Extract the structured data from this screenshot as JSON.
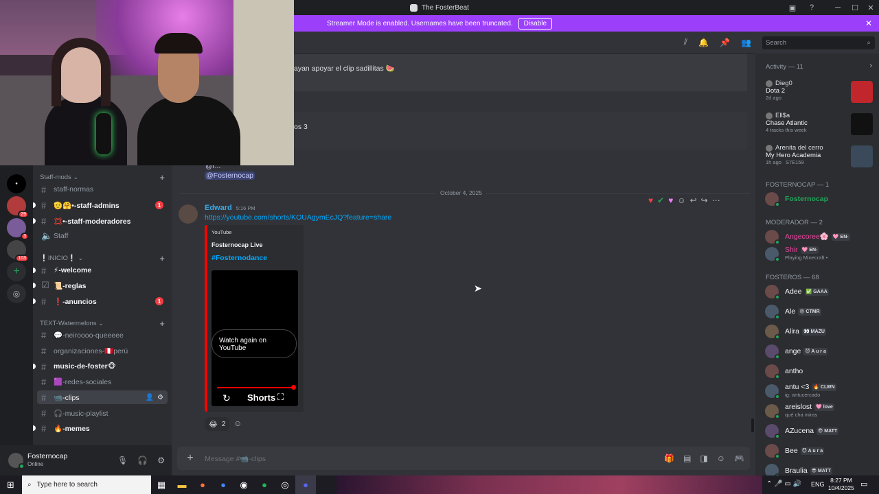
{
  "window": {
    "title": "The FosterBeat"
  },
  "banner": {
    "text": "Streamer Mode is enabled. Usernames have been truncated.",
    "button": "Disable"
  },
  "search": {
    "placeholder": "Search"
  },
  "servers": [
    {
      "badge": ""
    },
    {
      "badge": "29"
    },
    {
      "badge": "3"
    },
    {
      "badge": "103"
    }
  ],
  "sidebar": {
    "categories": [
      {
        "label": "Staff-mods"
      },
      {
        "label": "❕INICIO❕"
      },
      {
        "label": "TEXT-Watermelons"
      }
    ],
    "channels": [
      {
        "name": "staff-normas",
        "badge": ""
      },
      {
        "name": "🫡🤗•-staff-admins",
        "badge": "1"
      },
      {
        "name": "💢•-staff-moderadores",
        "badge": ""
      },
      {
        "name": "Staff",
        "badge": ""
      },
      {
        "name": "⚡-welcome",
        "badge": ""
      },
      {
        "name": "📜-reglas",
        "badge": ""
      },
      {
        "name": "❗-anuncios",
        "badge": "1"
      },
      {
        "name": "💬-neiroooo-queeeee",
        "badge": ""
      },
      {
        "name": "organizaciones-🇵🇪perú",
        "badge": ""
      },
      {
        "name": "music-de-foster🐵",
        "badge": ""
      },
      {
        "name": "🟪-redes-sociales",
        "badge": ""
      },
      {
        "name": "📹-clips",
        "badge": ""
      },
      {
        "name": "🎧-music-playlist",
        "badge": ""
      },
      {
        "name": "🔥-memes",
        "badge": ""
      }
    ]
  },
  "user": {
    "name": "Fosternocap",
    "status": "Online"
  },
  "chat": {
    "faded_texts": [
      "ayan apoyar el clip sadillitas 🍉",
      "os 3",
      "@r...",
      "@Fosternocap"
    ],
    "date_divider": "October 4, 2025",
    "message": {
      "author": "Edward",
      "time": "5:16 PM",
      "link": "https://youtube.com/shorts/KOUAgymEcJQ?feature=share",
      "embed": {
        "provider": "YouTube",
        "author": "Fosternocap Live",
        "title": "#Fosternodance",
        "player_text": "Watch again on YouTube",
        "shorts_label": "Shorts"
      },
      "reaction": {
        "emoji": "😂",
        "count": "2"
      }
    },
    "composer_placeholder": "Message #📹-clips"
  },
  "members": {
    "activity_header": "Activity — 11",
    "activities": [
      {
        "user": "Dieg0",
        "game": "Dota 2",
        "detail": "2d ago",
        "color": "#c0262b"
      },
      {
        "user": "Ell$a",
        "game": "Chase Atlantic",
        "detail": "4 tracks this week",
        "color": "#111111"
      },
      {
        "user": "Arenita del cerro",
        "game": "My Hero Academia",
        "detail": "1h ago",
        "detail2": "S7E159",
        "color": "#3a4a5a"
      }
    ],
    "groups": [
      {
        "header": "FOSTERNOCAP — 1",
        "list": [
          {
            "name": "Fosternocap",
            "color": "#23a55a",
            "tag": "",
            "sub": ""
          }
        ]
      },
      {
        "header": "MODERADOR — 2",
        "list": [
          {
            "name": "Angecoree🌸",
            "color": "#eb459e",
            "tag": "🩷 EN-",
            "sub": ""
          },
          {
            "name": "Shir",
            "color": "#eb459e",
            "tag": "🩷 EN-",
            "sub": "Playing Minecraft •"
          }
        ]
      },
      {
        "header": "FOSTEROS — 68",
        "list": [
          {
            "name": "Adee",
            "color": "#f2f3f5",
            "tag": "✅ GAAA",
            "sub": ""
          },
          {
            "name": "Ale",
            "color": "#f2f3f5",
            "tag": "😡 CTMR",
            "sub": ""
          },
          {
            "name": "Alira",
            "color": "#f2f3f5",
            "tag": "👀 MAZU",
            "sub": ""
          },
          {
            "name": "ange",
            "color": "#f2f3f5",
            "tag": "😈 A u r a",
            "sub": ""
          },
          {
            "name": "antho",
            "color": "#f2f3f5",
            "tag": "",
            "sub": ""
          },
          {
            "name": "antu <3",
            "color": "#f2f3f5",
            "tag": "🔥 CLWN",
            "sub": "ig: antucercado"
          },
          {
            "name": "areislost",
            "color": "#f2f3f5",
            "tag": "🩷 love",
            "sub": "qué cha miras"
          },
          {
            "name": "AZucena",
            "color": "#f2f3f5",
            "tag": "😎 MATT",
            "sub": ""
          },
          {
            "name": "Bee",
            "color": "#f2f3f5",
            "tag": "😈 A u r a",
            "sub": ""
          },
          {
            "name": "Braulia",
            "color": "#f2f3f5",
            "tag": "😎 MATT",
            "sub": ""
          }
        ]
      }
    ]
  },
  "taskbar": {
    "search_placeholder": "Type here to search",
    "lang": "ENG",
    "time": "8:27 PM",
    "date": "10/4/2025"
  }
}
